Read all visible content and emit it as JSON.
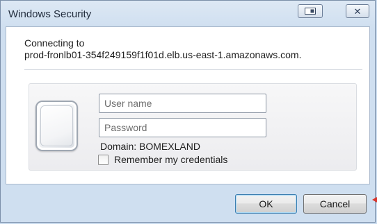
{
  "window": {
    "title": "Windows Security"
  },
  "prompt": {
    "line1": "Connecting to",
    "line2": "prod-fronlb01-354f249159f1f01d.elb.us-east-1.amazonaws.com."
  },
  "credentials": {
    "username_placeholder": "User name",
    "password_placeholder": "Password",
    "domain": "Domain: BOMEXLAND",
    "remember_label": "Remember my credentials",
    "remember_checked": false
  },
  "buttons": {
    "ok": "OK",
    "cancel": "Cancel"
  },
  "colors": {
    "accent": "#3c7fb1",
    "frame": "#c9dbee",
    "pointer": "#d9342b"
  }
}
